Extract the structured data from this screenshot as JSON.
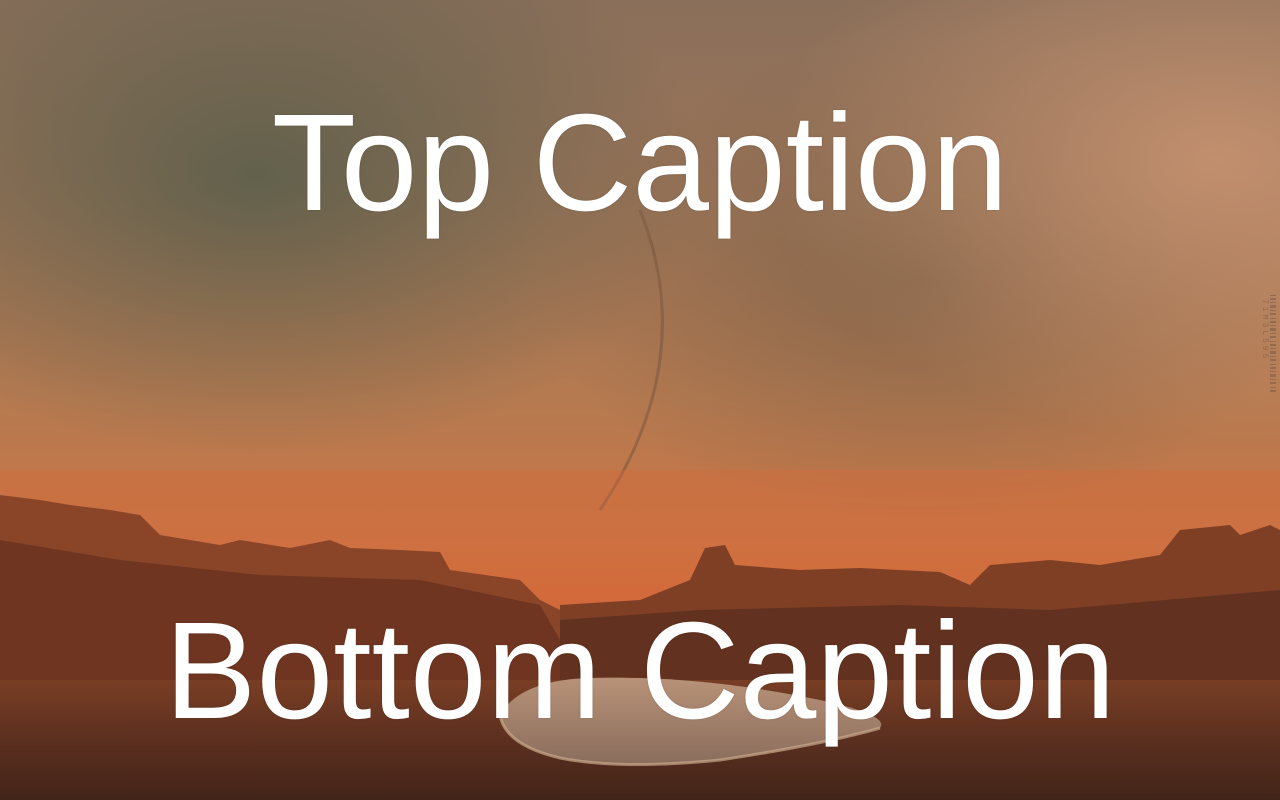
{
  "image": {
    "description_colors": {
      "sky_top": "#8d6a52",
      "sky_mid": "#b4784f",
      "horizon": "#d06a3a",
      "ground": "#5a3222",
      "cliff": "#8e4a2c",
      "lake": "#9b8573"
    }
  },
  "captions": {
    "top": "Top Caption",
    "bottom": "Bottom Caption"
  },
  "watermark": {
    "text": "71M3L595"
  }
}
